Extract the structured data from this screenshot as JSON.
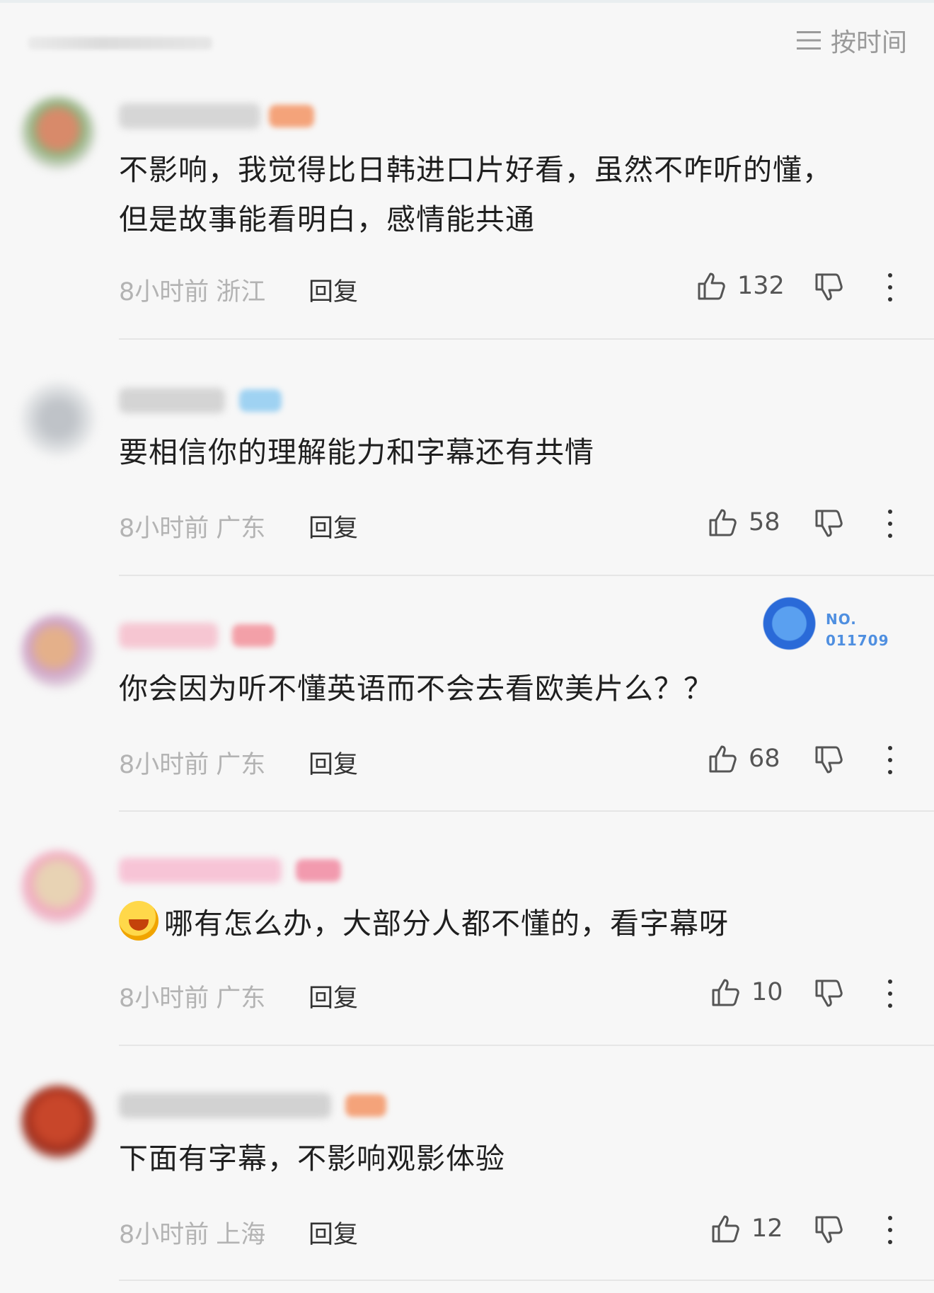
{
  "header": {
    "sort_label": "按时间",
    "sort_icon": "menu-lines-icon"
  },
  "comments": [
    {
      "text_line1": "不影响，我觉得比日韩进口片好看，虽然不咋听的懂，",
      "text_line2": "但是故事能看明白，感情能共通",
      "time": "8小时前",
      "location": "浙江",
      "reply": "回复",
      "likes": "132"
    },
    {
      "text_line1": "要相信你的理解能力和字幕还有共情",
      "time": "8小时前",
      "location": "广东",
      "reply": "回复",
      "likes": "58"
    },
    {
      "text_line1": "你会因为听不懂英语而不会去看欧美片么？？",
      "time": "8小时前",
      "location": "广东",
      "reply": "回复",
      "likes": "68",
      "fan_badge": {
        "label": "NO.",
        "number": "011709"
      }
    },
    {
      "text_line1": "哪有怎么办，大部分人都不懂的，看字幕呀",
      "emoji": "laughing-crying-emoji",
      "time": "8小时前",
      "location": "广东",
      "reply": "回复",
      "likes": "10"
    },
    {
      "text_line1": "下面有字幕，不影响观影体验",
      "time": "8小时前",
      "location": "上海",
      "reply": "回复",
      "likes": "12"
    }
  ],
  "colors": {
    "background": "#f7f7f7",
    "meta_text": "#b3b3b3",
    "primary_text": "#1f1f1f",
    "fan_badge_blue": "#4f8fe0"
  }
}
